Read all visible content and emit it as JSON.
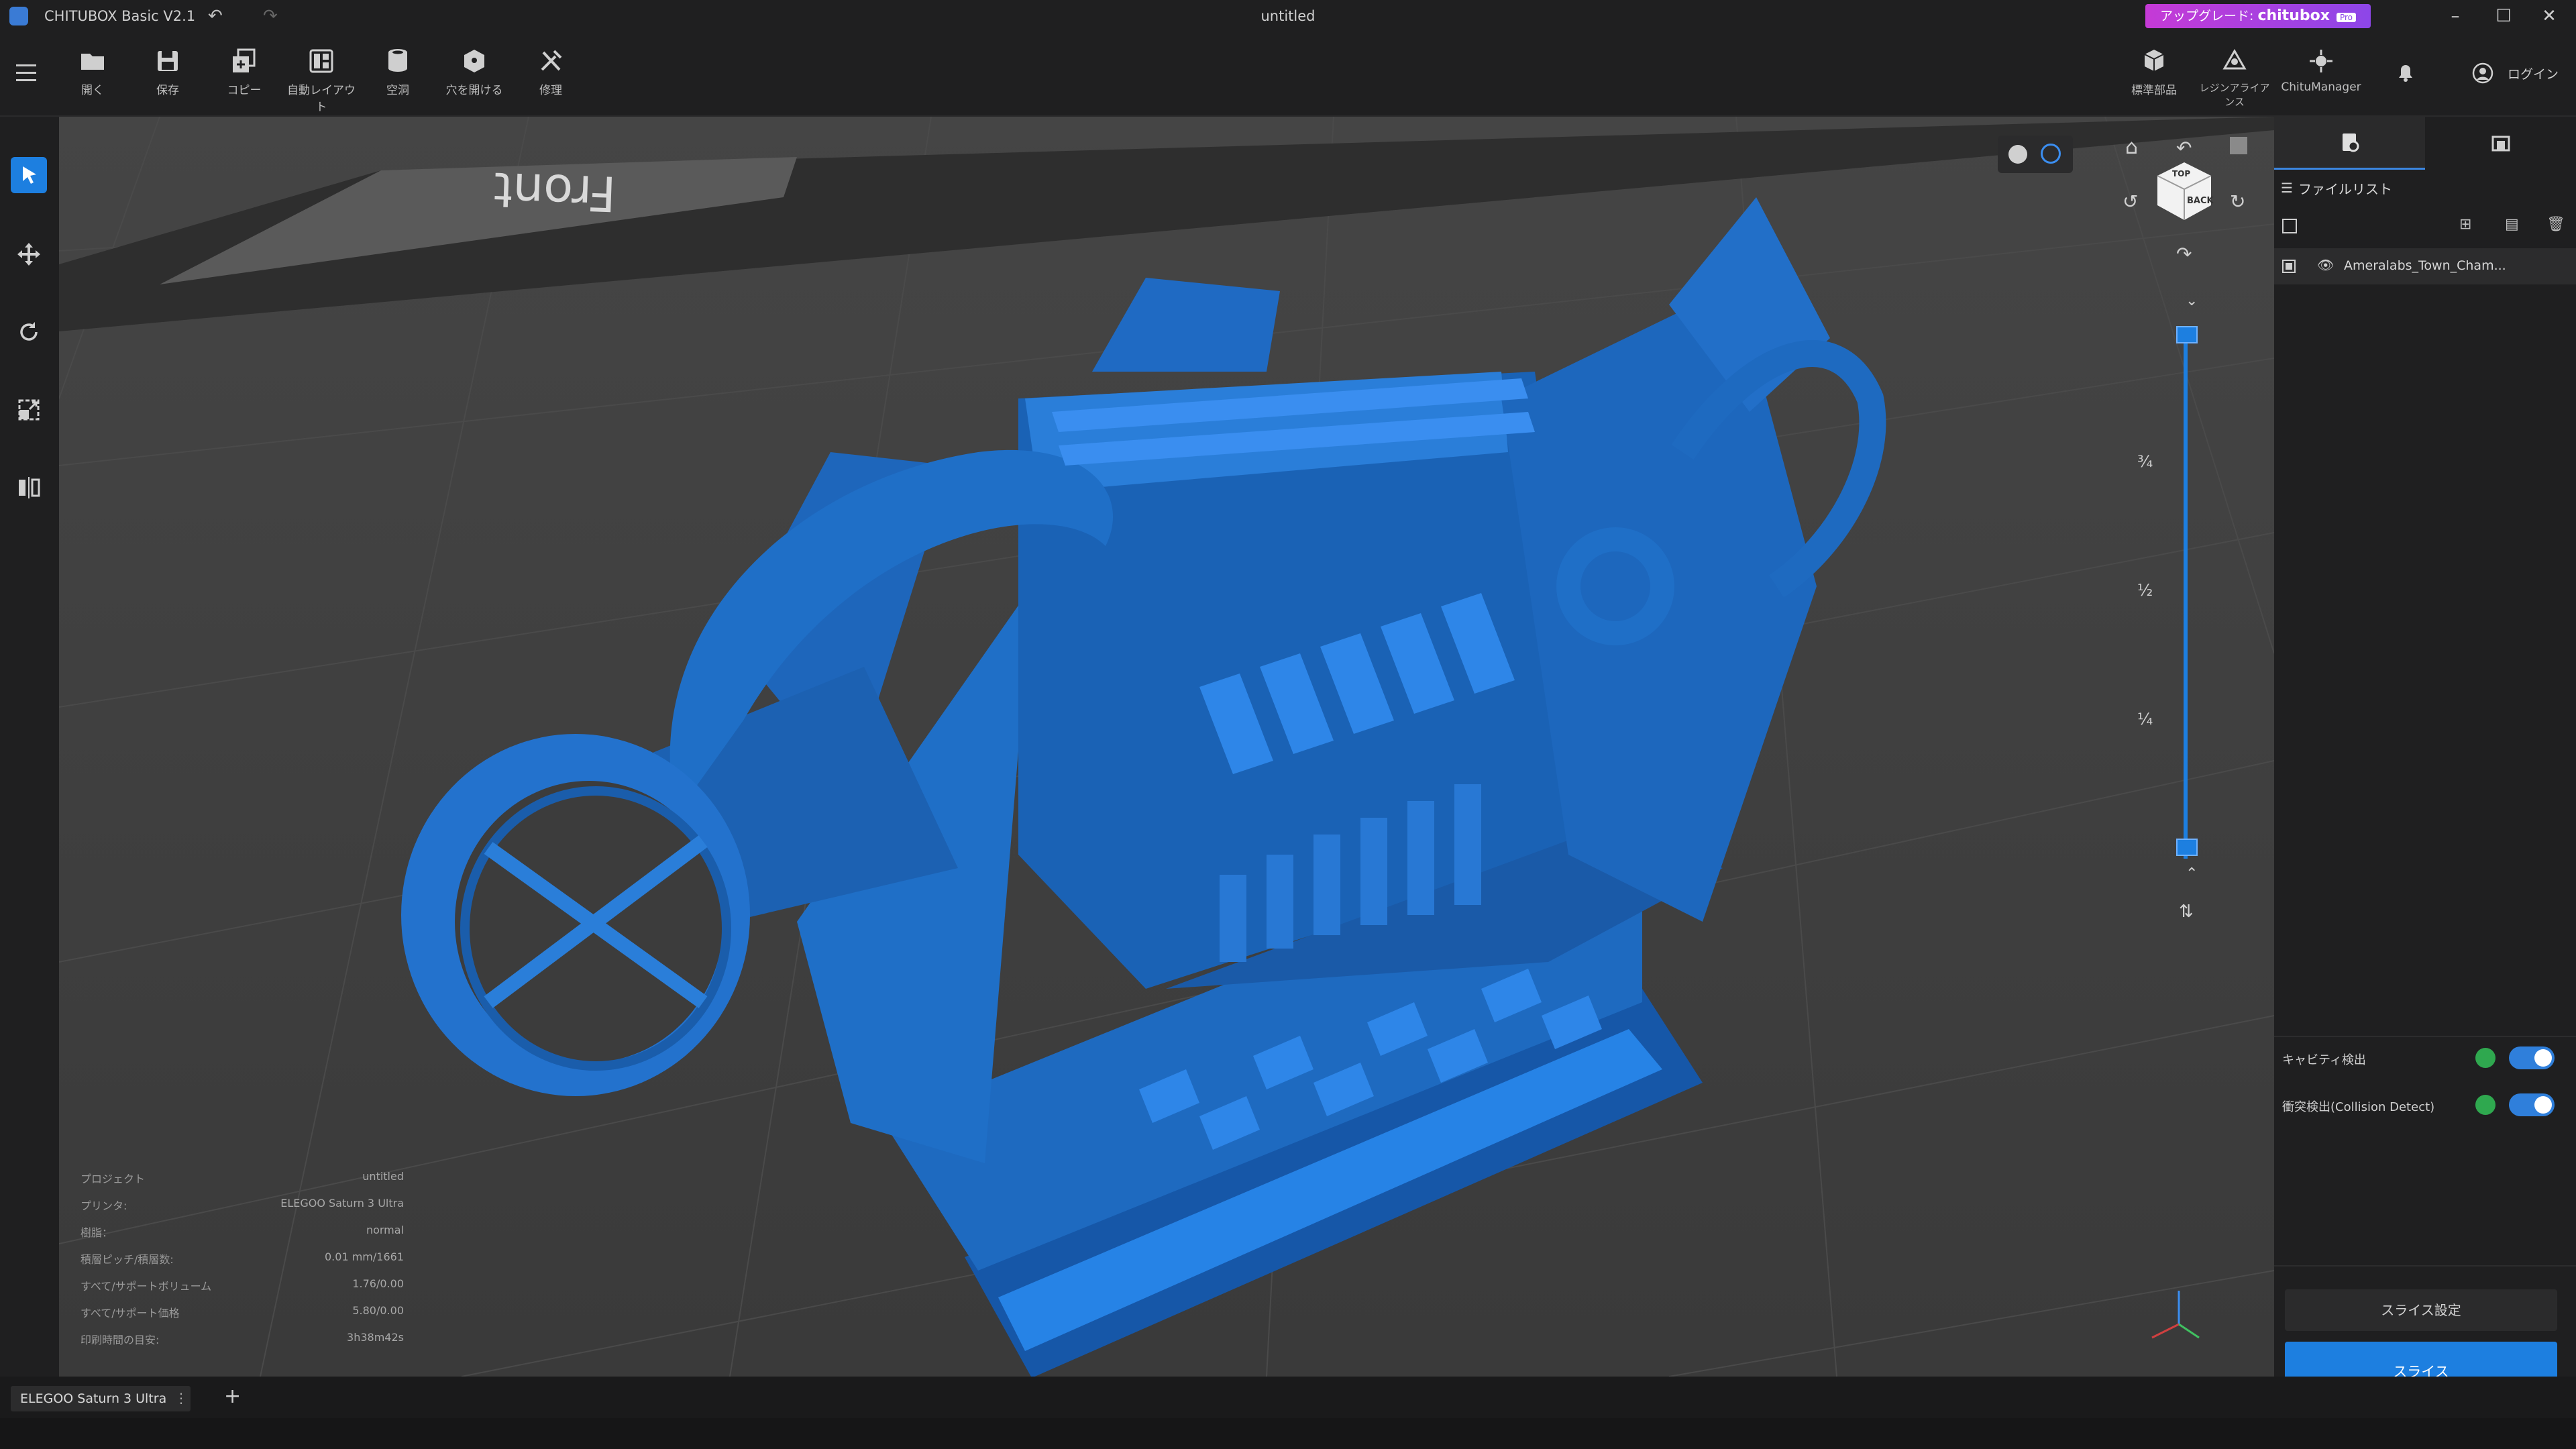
{
  "titlebar": {
    "app_title": "CHITUBOX Basic V2.1",
    "document_title": "untitled",
    "upgrade_prefix": "アップグレード:",
    "upgrade_brand": "chitubox",
    "upgrade_badge": "Pro"
  },
  "toolbar": {
    "tools": [
      {
        "label": "開く",
        "icon": "folder-open-icon"
      },
      {
        "label": "保存",
        "icon": "save-icon"
      },
      {
        "label": "コピー",
        "icon": "copy-icon"
      },
      {
        "label": "自動レイアウト",
        "icon": "auto-layout-icon"
      },
      {
        "label": "空洞",
        "icon": "hollow-icon"
      },
      {
        "label": "穴を開ける",
        "icon": "drill-hole-icon"
      },
      {
        "label": "修理",
        "icon": "repair-icon"
      }
    ],
    "right_tools": [
      {
        "label": "標準部品",
        "icon": "standard-parts-icon"
      },
      {
        "label": "レジンアライアンス",
        "icon": "resin-alliance-icon"
      },
      {
        "label": "ChituManager",
        "icon": "chitu-manager-icon"
      }
    ],
    "login_label": "ログイン"
  },
  "viewport": {
    "plate_label": "Front",
    "layer_slider": {
      "marks": [
        "¾",
        "½",
        "¼"
      ],
      "top_value": 1.0,
      "bottom_value": 0.0
    },
    "view_cube": {
      "top_face": "TOP",
      "side_face": "BACK"
    }
  },
  "info_panel": {
    "rows": [
      {
        "label": "プロジェクト",
        "value": "untitled"
      },
      {
        "label": "プリンタ:",
        "value": "ELEGOO Saturn 3 Ultra"
      },
      {
        "label": "樹脂：",
        "value": "normal"
      },
      {
        "label": "積層ピッチ/積層数:",
        "value": "0.01 mm/1661"
      },
      {
        "label": "すべて/サポートボリューム",
        "value": "1.76/0.00"
      },
      {
        "label": "すべて/サポート価格",
        "value": "5.80/0.00"
      },
      {
        "label": "印刷時間の目安:",
        "value": "3h38m42s"
      }
    ]
  },
  "right_panel": {
    "file_list_title": "ファイルリスト",
    "files": [
      {
        "name": "Ameralabs_Town_Cham...",
        "visible": true
      }
    ],
    "cavity_detect_label": "キャビティ検出",
    "cavity_detect_on": true,
    "collision_detect_label": "衝突検出(Collision Detect)",
    "collision_detect_on": true,
    "slice_settings_label": "スライス設定",
    "slice_label": "スライス"
  },
  "bottombar": {
    "printer_tab": "ELEGOO Saturn 3 Ultra",
    "add_tab": "+"
  },
  "colors": {
    "accent": "#1d7fe0",
    "model_blue": "#1f6fc4",
    "upgrade_purple": "#b03fdc",
    "viewport_bg": "#3c3c3c"
  }
}
